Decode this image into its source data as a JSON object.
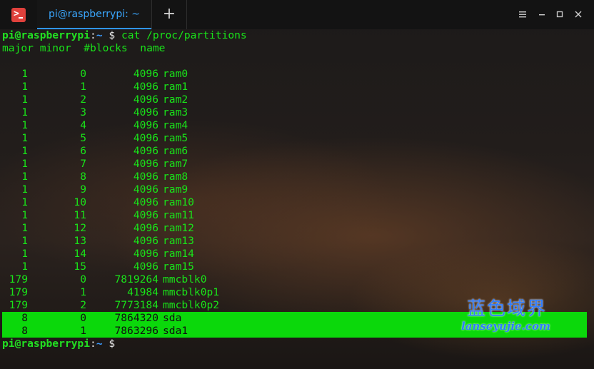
{
  "window": {
    "tab_title": "pi@raspberrypi: ~",
    "new_tab_glyph": "+",
    "minimize_glyph": "–",
    "maximize_glyph": "□",
    "close_glyph": "✕",
    "app_icon_glyph": ">",
    "accent_color": "#2f95ff"
  },
  "terminal": {
    "prompt_user": "pi@raspberrypi",
    "prompt_colon": ":",
    "prompt_path": "~",
    "prompt_dollar": "$",
    "command": "cat /proc/partitions",
    "header": "major minor  #blocks  name",
    "rows": [
      {
        "major": "1",
        "minor": "0",
        "blocks": "4096",
        "name": "ram0"
      },
      {
        "major": "1",
        "minor": "1",
        "blocks": "4096",
        "name": "ram1"
      },
      {
        "major": "1",
        "minor": "2",
        "blocks": "4096",
        "name": "ram2"
      },
      {
        "major": "1",
        "minor": "3",
        "blocks": "4096",
        "name": "ram3"
      },
      {
        "major": "1",
        "minor": "4",
        "blocks": "4096",
        "name": "ram4"
      },
      {
        "major": "1",
        "minor": "5",
        "blocks": "4096",
        "name": "ram5"
      },
      {
        "major": "1",
        "minor": "6",
        "blocks": "4096",
        "name": "ram6"
      },
      {
        "major": "1",
        "minor": "7",
        "blocks": "4096",
        "name": "ram7"
      },
      {
        "major": "1",
        "minor": "8",
        "blocks": "4096",
        "name": "ram8"
      },
      {
        "major": "1",
        "minor": "9",
        "blocks": "4096",
        "name": "ram9"
      },
      {
        "major": "1",
        "minor": "10",
        "blocks": "4096",
        "name": "ram10"
      },
      {
        "major": "1",
        "minor": "11",
        "blocks": "4096",
        "name": "ram11"
      },
      {
        "major": "1",
        "minor": "12",
        "blocks": "4096",
        "name": "ram12"
      },
      {
        "major": "1",
        "minor": "13",
        "blocks": "4096",
        "name": "ram13"
      },
      {
        "major": "1",
        "minor": "14",
        "blocks": "4096",
        "name": "ram14"
      },
      {
        "major": "1",
        "minor": "15",
        "blocks": "4096",
        "name": "ram15"
      },
      {
        "major": "179",
        "minor": "0",
        "blocks": "7819264",
        "name": "mmcblk0"
      },
      {
        "major": "179",
        "minor": "1",
        "blocks": "41984",
        "name": "mmcblk0p1"
      },
      {
        "major": "179",
        "minor": "2",
        "blocks": "7773184",
        "name": "mmcblk0p2"
      }
    ],
    "highlighted_rows": [
      {
        "major": "8",
        "minor": "0",
        "blocks": "7864320",
        "name": "sda"
      },
      {
        "major": "8",
        "minor": "1",
        "blocks": "7863296",
        "name": "sda1"
      }
    ],
    "highlight_color": "#0bd80b"
  },
  "watermark": {
    "chinese": "蓝色域界",
    "url": "lanseyujie.com"
  }
}
